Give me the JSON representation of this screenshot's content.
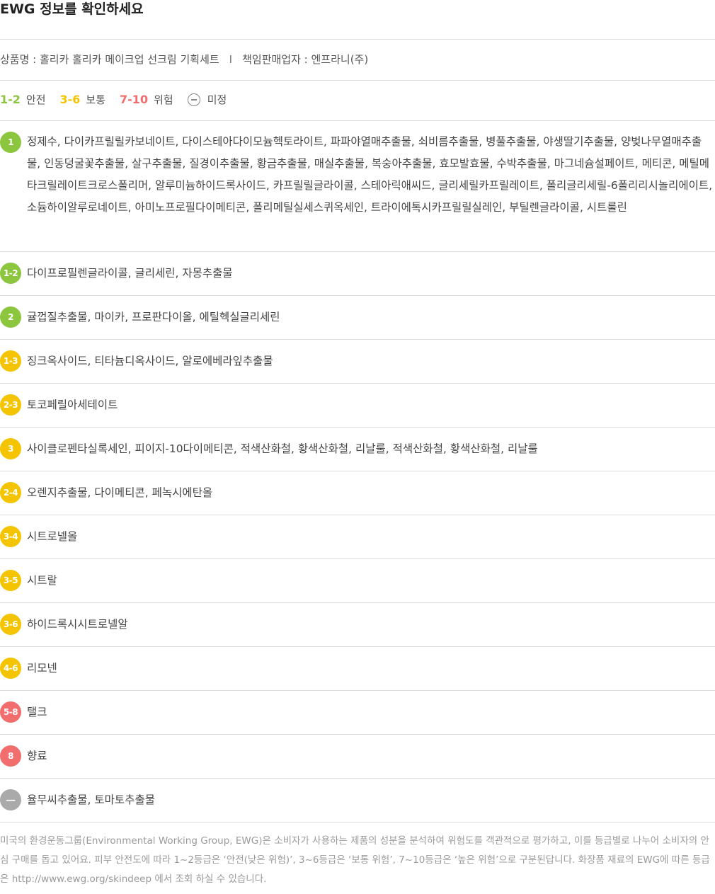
{
  "title": "EWG 정보를 확인하세요",
  "product": {
    "name_text": "상품명 : 홀리카 홀리카 메이크업 선크림 기획세트",
    "separator": "I",
    "seller_text": "책임판매업자 : 엔프라니(주)"
  },
  "legend": [
    {
      "range": "1-2",
      "label": "안전",
      "color": "#8cc63f"
    },
    {
      "range": "3-6",
      "label": "보통",
      "color": "#f5c400"
    },
    {
      "range": "7-10",
      "label": "위험",
      "color": "#f26d6d"
    },
    {
      "range": "",
      "label": "미정",
      "color": "#999999",
      "icon": "minus-circle-icon"
    }
  ],
  "rows": [
    {
      "grade": "1",
      "color": "#8cc63f",
      "ingredients": "정제수, 다이카프릴릴카보네이트, 다이스테아다이모늄헥토라이트, 파파야열매추출물, 쇠비름추출물, 병풀추출물, 야생딸기추출물, 양벚나무열매추출물, 인동덩굴꽃추출물, 살구추출물, 질경이추출물, 황금추출물, 매실추출물, 복숭아추출물, 효모발효물, 수박추출물, 마그네슘설페이트, 메티콘, 메틸메타크릴레이트크로스폴리머, 알루미늄하이드록사이드, 카프릴릴글라이콜, 스테아릭애씨드, 글리세릴카프릴레이트, 폴리글리세릴-6폴리리시놀리에이트, 소듐하이알루로네이트, 아미노프로필다이메티콘, 폴리메틸실세스퀴옥세인, 트라이에톡시카프릴릴실레인, 부틸렌글라이콜, 시트룰린"
    },
    {
      "grade": "1-2",
      "color": "#8cc63f",
      "ingredients": "다이프로필렌글라이콜, 글리세린, 자몽추출물"
    },
    {
      "grade": "2",
      "color": "#8cc63f",
      "ingredients": "귤껍질추출물, 마이카, 프로판다이올, 에틸헥실글리세린"
    },
    {
      "grade": "1-3",
      "color": "#f5c400",
      "ingredients": "징크옥사이드, 티타늄디옥사이드, 알로에베라잎추출물"
    },
    {
      "grade": "2-3",
      "color": "#f5c400",
      "ingredients": "토코페릴아세테이트"
    },
    {
      "grade": "3",
      "color": "#f5c400",
      "ingredients": "사이클로펜타실록세인, 피이지-10다이메티콘, 적색산화철, 황색산화철, 리날룰, 적색산화철, 황색산화철, 리날룰"
    },
    {
      "grade": "2-4",
      "color": "#f5c400",
      "ingredients": "오렌지추출물, 다이메티콘, 페녹시에탄올"
    },
    {
      "grade": "3-4",
      "color": "#f5c400",
      "ingredients": "시트로넬올"
    },
    {
      "grade": "3-5",
      "color": "#f5c400",
      "ingredients": "시트랄"
    },
    {
      "grade": "3-6",
      "color": "#f5c400",
      "ingredients": "하이드록시시트로넬알"
    },
    {
      "grade": "4-6",
      "color": "#f5c400",
      "ingredients": "리모넨"
    },
    {
      "grade": "5-8",
      "color": "#f26d6d",
      "ingredients": "탤크"
    },
    {
      "grade": "8",
      "color": "#f26d6d",
      "ingredients": "향료"
    },
    {
      "grade": "−",
      "color": "#aaaaaa",
      "ingredients": "율무씨추출물, 토마토추출물"
    }
  ],
  "note": "미국의 환경운동그룹(Environmental Working Group, EWG)은 소비자가 사용하는 제품의 성분을 분석하여 위험도를 객관적으로 평가하고, 이를 등급별로 나누어 소비자의 안심 구매를 돕고 있어요. 피부 안전도에 따라 1~2등급은 ‘안전(낮은 위험)’, 3~6등급은 ‘보통 위험’, 7~10등급은 ‘높은 위험’으로 구분된답니다. 화장품 재료의 EWG에 따른 등급은 http://www.ewg.org/skindeep 에서 조회 하실 수 있습니다."
}
